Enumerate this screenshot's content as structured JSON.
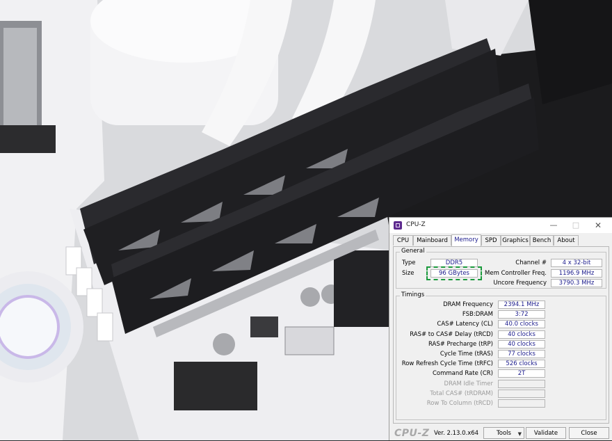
{
  "window": {
    "title": "CPU-Z"
  },
  "tabs": [
    "CPU",
    "Mainboard",
    "Memory",
    "SPD",
    "Graphics",
    "Bench",
    "About"
  ],
  "active_tab": "Memory",
  "general": {
    "group_title": "General",
    "type_label": "Type",
    "type_value": "DDR5",
    "size_label": "Size",
    "size_value": "96 GBytes",
    "channel_label": "Channel #",
    "channel_value": "4 x 32-bit",
    "mcf_label": "Mem Controller Freq.",
    "mcf_value": "1196.9 MHz",
    "uncore_label": "Uncore Frequency",
    "uncore_value": "3790.3 MHz"
  },
  "timings": {
    "group_title": "Timings",
    "rows": [
      {
        "label": "DRAM Frequency",
        "value": "2394.1 MHz"
      },
      {
        "label": "FSB:DRAM",
        "value": "3:72"
      },
      {
        "label": "CAS# Latency (CL)",
        "value": "40.0 clocks"
      },
      {
        "label": "RAS# to CAS# Delay (tRCD)",
        "value": "40 clocks"
      },
      {
        "label": "RAS# Precharge (tRP)",
        "value": "40 clocks"
      },
      {
        "label": "Cycle Time (tRAS)",
        "value": "77 clocks"
      },
      {
        "label": "Row Refresh Cycle Time (tRFC)",
        "value": "526 clocks"
      },
      {
        "label": "Command Rate (CR)",
        "value": "2T"
      },
      {
        "label": "DRAM Idle Timer",
        "value": ""
      },
      {
        "label": "Total CAS# (tRDRAM)",
        "value": ""
      },
      {
        "label": "Row To Column (tRCD)",
        "value": ""
      }
    ]
  },
  "footer": {
    "brand": "CPU-Z",
    "version": "Ver. 2.13.0.x64",
    "tools_label": "Tools",
    "validate_label": "Validate",
    "close_label": "Close"
  },
  "colors": {
    "value_text": "#1a1a8c",
    "highlight": "#1a9a3c",
    "ram_heatsink": "#1f1f22"
  },
  "icons": [
    "cpuz-app-icon",
    "minimize-icon",
    "maximize-icon",
    "close-icon",
    "dropdown-caret-icon"
  ]
}
